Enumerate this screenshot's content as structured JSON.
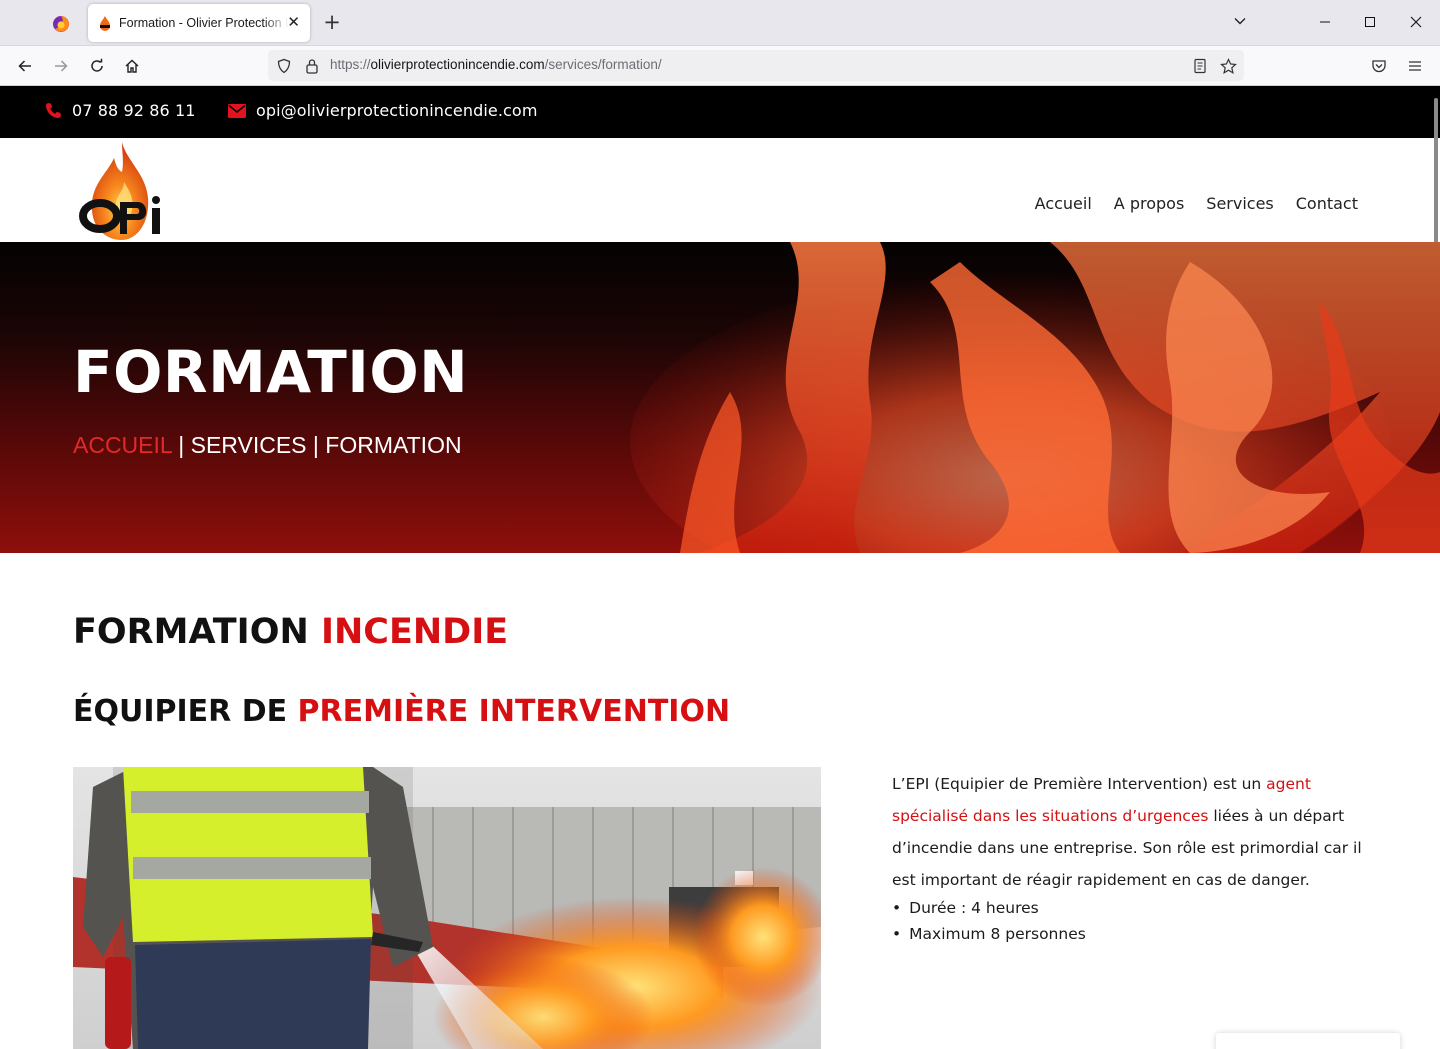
{
  "browser": {
    "tab_title": "Formation - Olivier Protection Incendie",
    "url_prefix": "https://",
    "url_domain": "olivierprotectionincendie.com",
    "url_path": "/services/formation/"
  },
  "topbar": {
    "phone": "07 88 92 86 11",
    "email": "opi@olivierprotectionincendie.com"
  },
  "nav": {
    "items": [
      {
        "label": "Accueil"
      },
      {
        "label": "A propos"
      },
      {
        "label": "Services"
      },
      {
        "label": "Contact"
      }
    ]
  },
  "hero": {
    "title": "FORMATION",
    "breadcrumb": {
      "home": "ACCUEIL",
      "sep1": " | ",
      "services": "SERVICES",
      "sep2": " | ",
      "current": "FORMATION"
    }
  },
  "section": {
    "title_black": "FORMATION ",
    "title_red": "INCENDIE",
    "subtitle_black": "ÉQUIPIER DE ",
    "subtitle_red": "PREMIÈRE INTERVENTION",
    "description_1": "L’EPI (Equipier de Première Intervention) est un ",
    "description_highlight": "agent spécialisé dans les situations d’urgences",
    "description_2": " liées à un départ d’incendie dans une entreprise. Son rôle est primordial car il est important de réagir rapidement en cas de danger.",
    "bullets": [
      "Durée : 4 heures",
      "Maximum 8 personnes"
    ]
  },
  "colors": {
    "accent_red": "#d60f12",
    "topbar_bg": "#000000"
  }
}
